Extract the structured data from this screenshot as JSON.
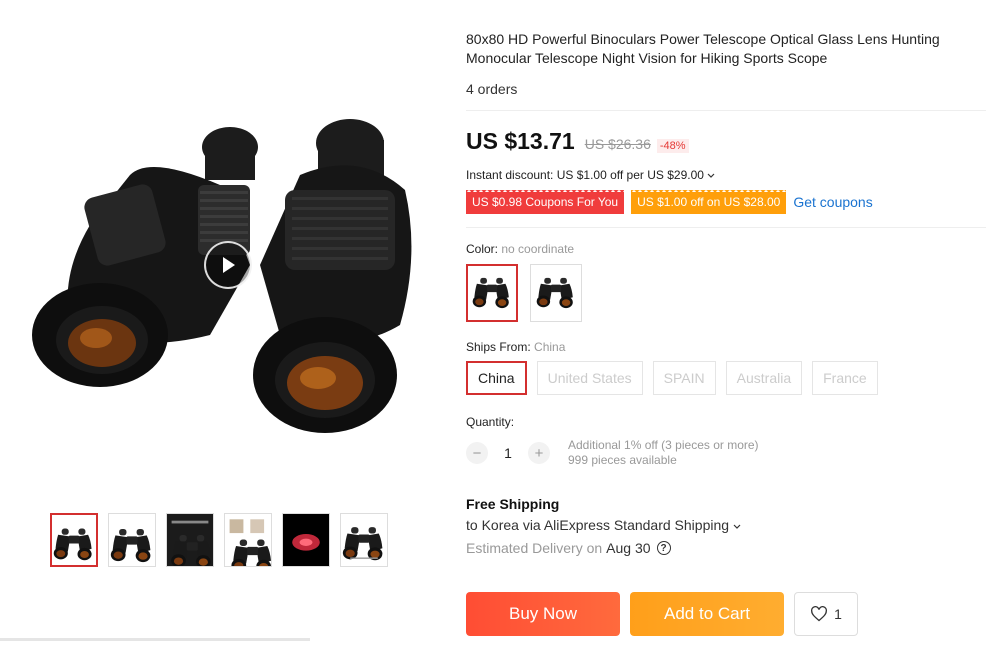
{
  "product": {
    "title": "80x80 HD Powerful Binoculars Power Telescope Optical Glass Lens Hunting Monocular Telescope Night Vision for Hiking Sports Scope",
    "orders": "4 orders"
  },
  "price": {
    "current": "US $13.71",
    "original": "US $26.36",
    "discount": "-48%"
  },
  "instant_discount": "Instant discount: US $1.00 off per US $29.00",
  "coupons": {
    "coupon1": "US $0.98 Coupons For You",
    "coupon2": "US $1.00 off on US $28.00",
    "get_coupons": "Get coupons"
  },
  "color": {
    "label": "Color:",
    "value": "no coordinate"
  },
  "ships_from": {
    "label": "Ships From:",
    "value": "China",
    "options": [
      "China",
      "United States",
      "SPAIN",
      "Australia",
      "France"
    ]
  },
  "quantity": {
    "label": "Quantity:",
    "minus": "−",
    "value": "1",
    "plus": "+",
    "note1": "Additional 1% off (3 pieces or more)",
    "note2": "999 pieces available"
  },
  "shipping": {
    "title": "Free Shipping",
    "via": "to Korea via AliExpress Standard Shipping",
    "delivery_label": "Estimated Delivery on",
    "delivery_date": "Aug 30"
  },
  "actions": {
    "buy_now": "Buy Now",
    "add_to_cart": "Add to Cart",
    "wish_count": "1"
  },
  "colors": {
    "accent_red": "#d32f2f",
    "buy_now": "#ff4d34",
    "add_to_cart": "#ff9f1a",
    "link": "#1a73d0"
  },
  "icons": [
    "play-icon",
    "chevron-down-icon",
    "help-icon",
    "heart-icon"
  ]
}
